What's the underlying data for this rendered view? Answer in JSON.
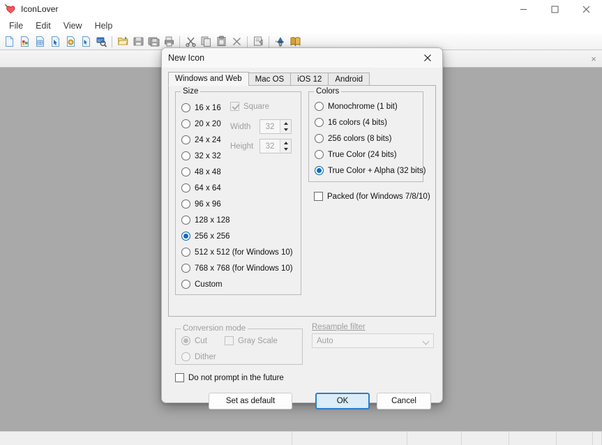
{
  "app": {
    "title": "IconLover",
    "logo_icon": "heart-paintbrush-icon",
    "window_controls": {
      "minimize": "minimize-icon",
      "maximize": "maximize-icon",
      "close": "close-icon"
    },
    "menu": [
      {
        "label": "File"
      },
      {
        "label": "Edit"
      },
      {
        "label": "View"
      },
      {
        "label": "Help"
      }
    ],
    "toolbar": [
      {
        "name": "new-icon-button",
        "icon": "new-document-icon"
      },
      {
        "name": "new-image-button",
        "icon": "new-image-icon"
      },
      {
        "name": "new-icon-library-button",
        "icon": "new-library-icon"
      },
      {
        "name": "new-cursor-button",
        "icon": "new-cursor-icon"
      },
      {
        "name": "new-icon-from-image-button",
        "icon": "coin-image-icon"
      },
      {
        "name": "new-animated-cursor-button",
        "icon": "cursor-doc-icon"
      },
      {
        "name": "extract-icons-button",
        "icon": "ico-search-icon"
      },
      {
        "name": "separator",
        "icon": "separator"
      },
      {
        "name": "open-button",
        "icon": "open-folder-icon"
      },
      {
        "name": "save-button",
        "icon": "save-disk-icon"
      },
      {
        "name": "save-all-button",
        "icon": "save-all-icon"
      },
      {
        "name": "print-button",
        "icon": "printer-icon"
      },
      {
        "name": "separator",
        "icon": "separator"
      },
      {
        "name": "cut-button",
        "icon": "scissors-icon"
      },
      {
        "name": "copy-button",
        "icon": "copy-icon"
      },
      {
        "name": "paste-button",
        "icon": "paste-icon"
      },
      {
        "name": "delete-button",
        "icon": "delete-x-icon"
      },
      {
        "name": "separator",
        "icon": "separator"
      },
      {
        "name": "properties-button",
        "icon": "properties-icon"
      },
      {
        "name": "separator",
        "icon": "separator"
      },
      {
        "name": "wizard-button",
        "icon": "wizard-hat-icon"
      },
      {
        "name": "help-button",
        "icon": "book-icon"
      }
    ],
    "document_tabstrip": {
      "close_label": "×",
      "tabs": []
    },
    "statusbar": {
      "cells": [
        "",
        "",
        "",
        "",
        "",
        "",
        ""
      ]
    }
  },
  "dialog": {
    "title": "New Icon",
    "close_label": "✕",
    "tabs": [
      {
        "label": "Windows and Web",
        "active": true
      },
      {
        "label": "Mac OS",
        "active": false
      },
      {
        "label": "iOS 12",
        "active": false
      },
      {
        "label": "Android",
        "active": false
      }
    ],
    "size_group": {
      "label": "Size",
      "options": [
        {
          "label": "16 x 16",
          "selected": false
        },
        {
          "label": "20 x 20",
          "selected": false
        },
        {
          "label": "24 x 24",
          "selected": false
        },
        {
          "label": "32 x 32",
          "selected": false
        },
        {
          "label": "48 x 48",
          "selected": false
        },
        {
          "label": "64 x 64",
          "selected": false
        },
        {
          "label": "96 x 96",
          "selected": false
        },
        {
          "label": "128 x 128",
          "selected": false
        },
        {
          "label": "256 x 256",
          "selected": true
        },
        {
          "label": "512 x 512 (for Windows 10)",
          "selected": false
        },
        {
          "label": "768 x 768 (for Windows 10)",
          "selected": false
        },
        {
          "label": "Custom",
          "selected": false
        }
      ],
      "square": {
        "label": "Square",
        "checked": true,
        "disabled": true
      },
      "width": {
        "label": "Width",
        "value": "32",
        "disabled": true
      },
      "height": {
        "label": "Height",
        "value": "32",
        "disabled": true
      }
    },
    "colors_group": {
      "label": "Colors",
      "options": [
        {
          "label": "Monochrome (1 bit)",
          "selected": false
        },
        {
          "label": "16 colors (4 bits)",
          "selected": false
        },
        {
          "label": "256 colors (8 bits)",
          "selected": false
        },
        {
          "label": "True Color (24 bits)",
          "selected": false
        },
        {
          "label": "True Color + Alpha (32 bits)",
          "selected": true
        }
      ]
    },
    "packed": {
      "label": "Packed (for Windows 7/8/10)",
      "checked": false
    },
    "conversion_mode": {
      "label": "Conversion mode",
      "disabled": true,
      "options": [
        {
          "label": "Cut",
          "selected": true
        },
        {
          "label": "Dither",
          "selected": false
        }
      ],
      "gray_scale": {
        "label": "Gray Scale",
        "checked": false
      }
    },
    "resample_filter": {
      "label": "Resample filter",
      "value": "Auto",
      "disabled": true,
      "options": [
        "Auto"
      ]
    },
    "do_not_prompt": {
      "label": "Do not prompt in the future",
      "checked": false
    },
    "buttons": {
      "set_as_default": "Set as default",
      "ok": "OK",
      "cancel": "Cancel"
    }
  },
  "colors": {
    "accent": "#0f6cbd",
    "default_button_border": "#2a7fc9",
    "default_button_fill": "#dcecf8",
    "workspace": "#a9a9a9",
    "dialog_bg": "#f0f0f0",
    "disabled_text": "#9e9e9e"
  }
}
